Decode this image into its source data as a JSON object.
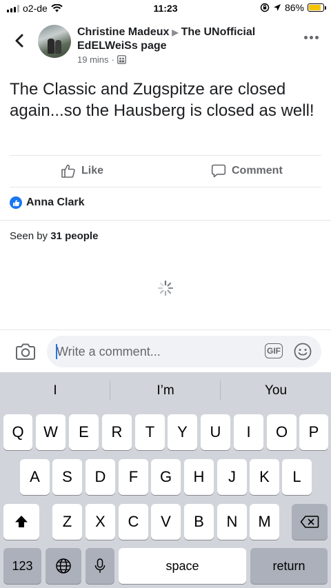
{
  "status": {
    "carrier": "o2-de",
    "time": "11:23",
    "battery": "86%",
    "battery_level": 0.86
  },
  "post": {
    "author": "Christine Madeux",
    "group": "The UNofficial EdELWeiSs page",
    "time": "19 mins",
    "separator": "·",
    "text": "The Classic and Zugspitze are closed again...so the Hausberg is closed as well!"
  },
  "actions": {
    "like": "Like",
    "comment": "Comment"
  },
  "reactions": {
    "name": "Anna Clark"
  },
  "seen": {
    "prefix": "Seen by",
    "count": "31 people"
  },
  "comment_box": {
    "placeholder": "Write a comment...",
    "gif": "GIF"
  },
  "keyboard": {
    "suggestions": [
      "I",
      "I’m",
      "You"
    ],
    "row1": [
      "Q",
      "W",
      "E",
      "R",
      "T",
      "Y",
      "U",
      "I",
      "O",
      "P"
    ],
    "row2": [
      "A",
      "S",
      "D",
      "F",
      "G",
      "H",
      "J",
      "K",
      "L"
    ],
    "row3": [
      "Z",
      "X",
      "C",
      "V",
      "B",
      "N",
      "M"
    ],
    "numbers": "123",
    "space": "space",
    "return": "return"
  },
  "colors": {
    "accent": "#1877f2",
    "text": "#1c1e21",
    "secondary": "#65676b"
  }
}
